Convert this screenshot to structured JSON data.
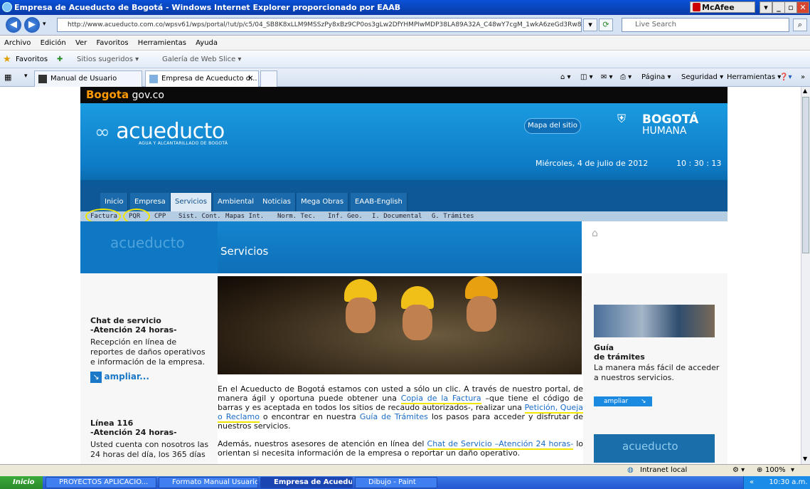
{
  "window": {
    "title": "Empresa de Acueducto de Bogotá - Windows Internet Explorer proporcionado por EAAB",
    "mcafee": "McAfee"
  },
  "address": {
    "url": "http://www.acueducto.com.co/wpsv61/wps/portal/!ut/p/c5/04_SB8K8xLLM9MSSzPy8xBz9CP0os3gLw2DfYHMPIwMDP38LA89A32A_C48wY7cgM_1wkA6zeGd3Rw8Tcx",
    "search_placeholder": "Live Search"
  },
  "menu": [
    "Archivo",
    "Edición",
    "Ver",
    "Favoritos",
    "Herramientas",
    "Ayuda"
  ],
  "favorites": {
    "label": "Favoritos",
    "items": [
      "Sitios sugeridos ▾",
      "Galería de Web Slice ▾"
    ]
  },
  "tabs": [
    {
      "label": "Manual de Usuario Ejemplo"
    },
    {
      "label": "Empresa de Acueducto d..."
    }
  ],
  "commands": [
    "Página ▾",
    "Seguridad ▾",
    "Herramientas ▾"
  ],
  "site": {
    "gov": {
      "brand": "Bogota",
      "suffix": "gov.co"
    },
    "logo": {
      "name": "acueducto",
      "tagline": "AGUA Y ALCANTARILLADO DE BOGOTÁ"
    },
    "mapa": "Mapa del sitio",
    "bogota_humana": {
      "line1": "BOGOTÁ",
      "line2": "HUMANA"
    },
    "date": "Miércoles, 4 de julio de 2012",
    "time": "10 : 30 : 13",
    "nav": [
      "Inicio",
      "Empresa",
      "Servicios",
      "Ambiental",
      "Noticias",
      "Mega Obras",
      "EAAB-English"
    ],
    "subnav": [
      "Factura",
      "PQR",
      "CPP",
      "Sist. Cont.",
      "Mapas Int.",
      "Norm. Tec.",
      "Inf. Geo.",
      "I. Documental",
      "G. Trámites"
    ],
    "section_title": "Servicios",
    "chat": {
      "title": "Chat de servicio",
      "subtitle": "-Atención 24 horas-",
      "body": "Recepción en línea de reportes de daños operativos e información de la empresa.",
      "link": "ampliar..."
    },
    "linea": {
      "title": "Línea 116",
      "subtitle": "-Atención 24 horas-",
      "body": "Usted cuenta con nosotros las 24 horas del día, los 365 días"
    },
    "main": {
      "p1_a": "En el Acueducto de Bogotá estamos con usted a sólo un clic. A través de nuestro portal, de manera ágil y oportuna puede obtener una ",
      "p1_link1": "Copia de la Factura",
      "p1_b": " –que tiene el código de barras y es aceptada en todos los sitios de recaudo autorizados-, realizar una ",
      "p1_link2": "Petición, Queja o Reclamo",
      "p1_c": " o encontrar en nuestra ",
      "p1_link3": "Guía de Trámites",
      "p1_d": " los pasos para acceder y disfrutar de nuestros servicios.",
      "p2_a": "Además, nuestros asesores de atención en línea del ",
      "p2_link": "Chat de Servicio –Atención 24 horas-",
      "p2_b": " lo orientan si necesita información de la empresa o reportar un daño operativo."
    },
    "guia": {
      "title1": "Guía",
      "title2": "de trámites",
      "body": "La manera más fácil de acceder a nuestros servicios.",
      "button": "ampliar"
    }
  },
  "status": {
    "zone": "Intranet local",
    "zoom": "100%"
  },
  "taskbar": {
    "start": "Inicio",
    "items": [
      "PROYECTOS APLICACIO...",
      "Formato Manual Usuario ...",
      "Empresa de Acueduct...",
      "Dibujo - Paint"
    ],
    "clock": "10:30 a.m."
  }
}
